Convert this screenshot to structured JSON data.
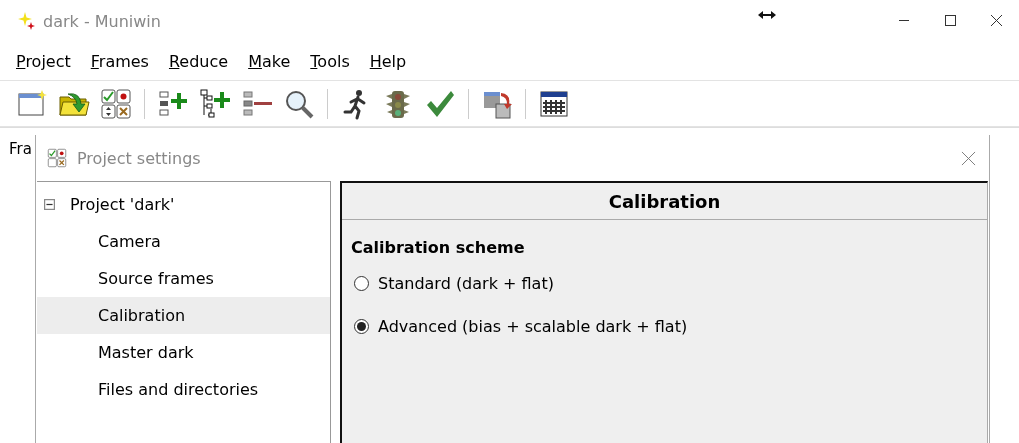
{
  "window": {
    "title": "dark - Muniwin"
  },
  "menu": [
    {
      "accel": "P",
      "rest": "roject"
    },
    {
      "accel": "F",
      "rest": "rames"
    },
    {
      "accel": "R",
      "rest": "educe"
    },
    {
      "accel": "M",
      "rest": "ake"
    },
    {
      "accel": "T",
      "rest": "ools"
    },
    {
      "accel": "H",
      "rest": "elp"
    }
  ],
  "main": {
    "label": "Fra"
  },
  "dialog": {
    "title": "Project settings",
    "tree": [
      {
        "label": "Project 'dark'",
        "expanded": true,
        "selected": false,
        "children": [
          {
            "label": "Camera",
            "selected": false
          },
          {
            "label": "Source frames",
            "selected": false
          },
          {
            "label": "Calibration",
            "selected": true
          },
          {
            "label": "Master dark",
            "selected": false
          },
          {
            "label": "Files and directories",
            "selected": false
          }
        ]
      }
    ],
    "page": {
      "heading": "Calibration",
      "section": "Calibration scheme",
      "options": [
        {
          "label": "Standard (dark + flat)",
          "selected": false
        },
        {
          "label": "Advanced (bias + scalable dark + flat)",
          "selected": true
        }
      ]
    }
  }
}
